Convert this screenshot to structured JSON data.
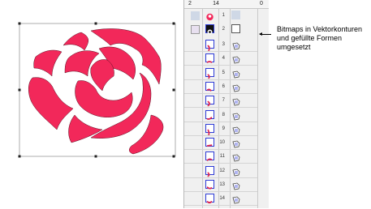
{
  "panel": {
    "headers": [
      "2",
      "14",
      "",
      "0"
    ],
    "rows": [
      {
        "num": "1"
      },
      {
        "num": "2"
      },
      {
        "num": "3"
      },
      {
        "num": "4"
      },
      {
        "num": "5"
      },
      {
        "num": "6"
      },
      {
        "num": "7"
      },
      {
        "num": "8"
      },
      {
        "num": "9"
      },
      {
        "num": "10"
      },
      {
        "num": "11"
      },
      {
        "num": "12"
      },
      {
        "num": "13"
      },
      {
        "num": "14"
      }
    ]
  },
  "annotation": {
    "text": "Bitmaps in Vektorkonturen und gefüllte Formen umgesetzt"
  },
  "colors": {
    "rose": "#f2285a",
    "selection": "#2d3ad6"
  }
}
